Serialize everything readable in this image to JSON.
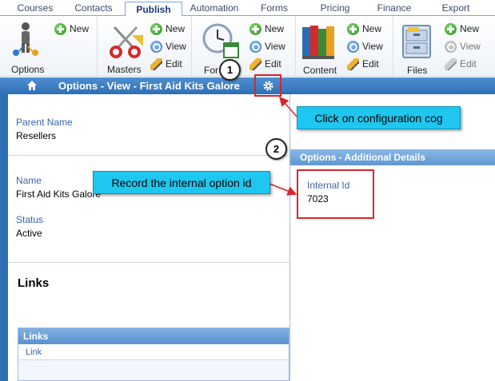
{
  "tabs": [
    {
      "label": "Courses"
    },
    {
      "label": "Contacts"
    },
    {
      "label": "Publish"
    },
    {
      "label": "Automation"
    },
    {
      "label": "Forms"
    },
    {
      "label": "Pricing"
    },
    {
      "label": "Finance"
    },
    {
      "label": "Export"
    }
  ],
  "ribbon": {
    "options": {
      "label": "Options",
      "new": "New"
    },
    "masters": {
      "label": "Masters",
      "new": "New",
      "view": "View",
      "edit": "Edit"
    },
    "forms": {
      "label": "For",
      "new": "New",
      "view": "View",
      "edit": "Edit"
    },
    "content": {
      "label": "Content",
      "new": "New",
      "view": "View",
      "edit": "Edit"
    },
    "files": {
      "label": "Files",
      "new": "New",
      "view": "View",
      "edit": "Edit"
    }
  },
  "pagebar": {
    "title": "Options - View - First Aid Kits Galore"
  },
  "main": {
    "parent_name_label": "Parent Name",
    "parent_name_value": "Resellers",
    "name_label": "Name",
    "name_value": "First Aid Kits Galore",
    "status_label": "Status",
    "status_value": "Active",
    "links_heading": "Links",
    "links_panel_title": "Links",
    "links_column": "Link"
  },
  "right_panel": {
    "title": "Options - Additional Details",
    "internal_id_label": "Internal Id",
    "internal_id_value": "7023"
  },
  "annotations": {
    "badge1": "1",
    "badge2": "2",
    "callout1": "Click on configuration cog",
    "callout2": "Record the internal option id",
    "highlight_color": "#d9262b",
    "callout_color": "#1ec7f0"
  }
}
